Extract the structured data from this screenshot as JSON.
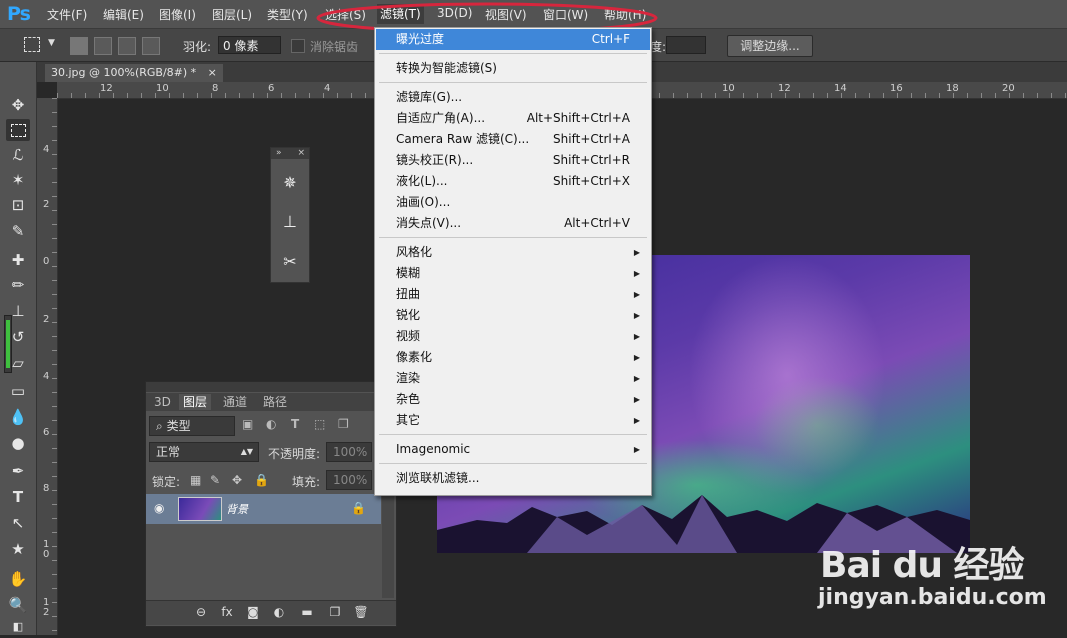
{
  "app": {
    "logo": "Ps"
  },
  "menubar": {
    "items": [
      "文件(F)",
      "编辑(E)",
      "图像(I)",
      "图层(L)",
      "类型(Y)",
      "选择(S)",
      "滤镜(T)",
      "3D(D)",
      "视图(V)",
      "窗口(W)",
      "帮助(H)"
    ],
    "active_index": 6
  },
  "options": {
    "feather_label": "羽化:",
    "feather_value": "0 像素",
    "antialias_label": "消除锯齿",
    "style_label": "度:",
    "refine_edge": "调整边缘..."
  },
  "document": {
    "tab_title": "30.jpg @ 100%(RGB/8#) *",
    "close": "×"
  },
  "ruler": {
    "h_ticks": [
      "12",
      "10",
      "8",
      "6",
      "4",
      "10",
      "12",
      "14",
      "16",
      "18",
      "20"
    ],
    "v_ticks": [
      "4",
      "2",
      "0",
      "2",
      "4",
      "6",
      "8",
      "1\n0",
      "1\n2"
    ]
  },
  "filter_menu": {
    "items": [
      {
        "label": "曝光过度",
        "shortcut": "Ctrl+F",
        "highlighted": true
      },
      {
        "sep": true
      },
      {
        "label": "转换为智能滤镜(S)"
      },
      {
        "sep": true
      },
      {
        "label": "滤镜库(G)..."
      },
      {
        "label": "自适应广角(A)...",
        "shortcut": "Alt+Shift+Ctrl+A"
      },
      {
        "label": "Camera Raw 滤镜(C)...",
        "shortcut": "Shift+Ctrl+A"
      },
      {
        "label": "镜头校正(R)...",
        "shortcut": "Shift+Ctrl+R"
      },
      {
        "label": "液化(L)...",
        "shortcut": "Shift+Ctrl+X"
      },
      {
        "label": "油画(O)..."
      },
      {
        "label": "消失点(V)...",
        "shortcut": "Alt+Ctrl+V"
      },
      {
        "sep": true
      },
      {
        "label": "风格化",
        "submenu": true
      },
      {
        "label": "模糊",
        "submenu": true
      },
      {
        "label": "扭曲",
        "submenu": true
      },
      {
        "label": "锐化",
        "submenu": true
      },
      {
        "label": "视频",
        "submenu": true
      },
      {
        "label": "像素化",
        "submenu": true
      },
      {
        "label": "渲染",
        "submenu": true
      },
      {
        "label": "杂色",
        "submenu": true
      },
      {
        "label": "其它",
        "submenu": true
      },
      {
        "sep": true
      },
      {
        "label": "Imagenomic",
        "submenu": true
      },
      {
        "sep": true
      },
      {
        "label": "浏览联机滤镜..."
      }
    ]
  },
  "layers_panel": {
    "tabs": [
      "3D",
      "图层",
      "通道",
      "路径"
    ],
    "active_tab": 1,
    "kind_filter": "类型",
    "blend_mode": "正常",
    "opacity_label": "不透明度:",
    "opacity_value": "100%",
    "lock_label": "锁定:",
    "fill_label": "填充:",
    "fill_value": "100%",
    "layer_name": "背景",
    "bottom_icons": [
      "link-icon",
      "fx-icon",
      "mask-icon",
      "adjustment-icon",
      "folder-icon",
      "new-layer-icon",
      "trash-icon"
    ]
  },
  "watermark": {
    "brand": "Bai du 经验",
    "url": "jingyan.baidu.com"
  },
  "colors": {
    "annotation": "#d7263d",
    "menu_highlight": "#3f87d9",
    "ps_blue": "#31a8ff"
  }
}
